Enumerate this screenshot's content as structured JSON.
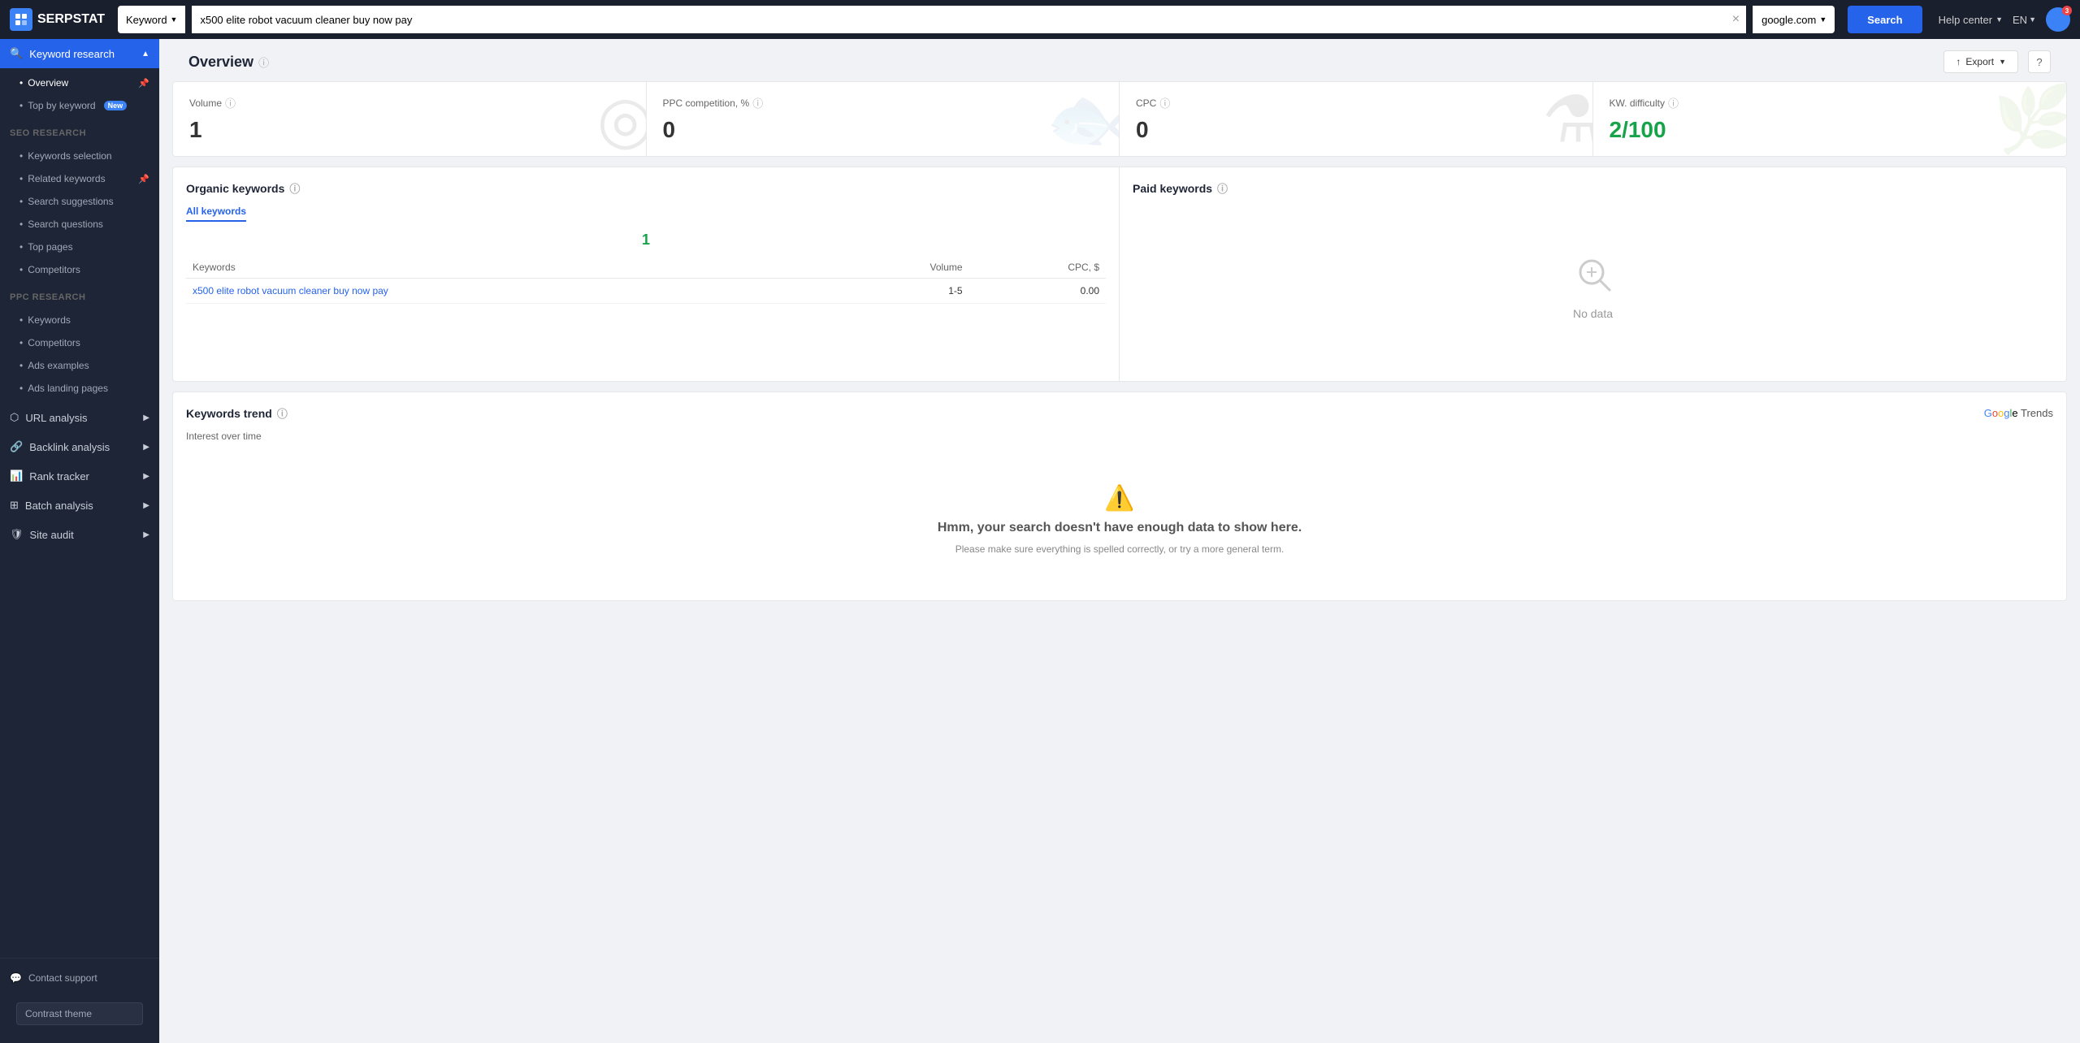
{
  "topbar": {
    "logo": "SERPSTAT",
    "search_type": "Keyword",
    "search_value": "x500 elite robot vacuum cleaner buy now pay",
    "engine": "google.com",
    "search_label": "Search",
    "help_center": "Help center",
    "lang": "EN",
    "avatar_initials": "3"
  },
  "sidebar": {
    "keyword_research_label": "Keyword research",
    "overview_label": "Overview",
    "top_by_keyword_label": "Top by keyword",
    "new_badge": "New",
    "seo_research_label": "SEO research",
    "keywords_selection_label": "Keywords selection",
    "related_keywords_label": "Related keywords",
    "search_suggestions_label": "Search suggestions",
    "search_questions_label": "Search questions",
    "top_pages_label": "Top pages",
    "competitors_label": "Competitors",
    "ppc_research_label": "PPC research",
    "ppc_keywords_label": "Keywords",
    "ppc_competitors_label": "Competitors",
    "ads_examples_label": "Ads examples",
    "ads_landing_label": "Ads landing pages",
    "url_analysis_label": "URL analysis",
    "backlink_analysis_label": "Backlink analysis",
    "rank_tracker_label": "Rank tracker",
    "batch_analysis_label": "Batch analysis",
    "site_audit_label": "Site audit",
    "contact_support_label": "Contact support",
    "contrast_theme_label": "Contrast theme"
  },
  "overview": {
    "title": "Overview",
    "export_label": "Export",
    "help_label": "?",
    "volume_label": "Volume",
    "volume_value": "1",
    "ppc_label": "PPC competition, %",
    "ppc_value": "0",
    "cpc_label": "CPC",
    "cpc_value": "0",
    "kw_diff_label": "KW. difficulty",
    "kw_diff_value": "2/100"
  },
  "organic_keywords": {
    "title": "Organic keywords",
    "tab_all": "All keywords",
    "count": "1",
    "col_keywords": "Keywords",
    "col_volume": "Volume",
    "col_cpc": "CPC, $",
    "rows": [
      {
        "keyword": "x500 elite robot vacuum cleaner buy now pay",
        "volume": "1-5",
        "cpc": "0.00"
      }
    ]
  },
  "paid_keywords": {
    "title": "Paid keywords",
    "no_data": "No data"
  },
  "keywords_trend": {
    "title": "Keywords trend",
    "interest_label": "Interest over time",
    "google_trends": [
      "G",
      "o",
      "o",
      "g",
      "l",
      "e",
      " Trends"
    ],
    "trend_msg": "Hmm, your search doesn't have enough data to show here.",
    "trend_sub": "Please make sure everything is spelled correctly, or try a more general term."
  }
}
